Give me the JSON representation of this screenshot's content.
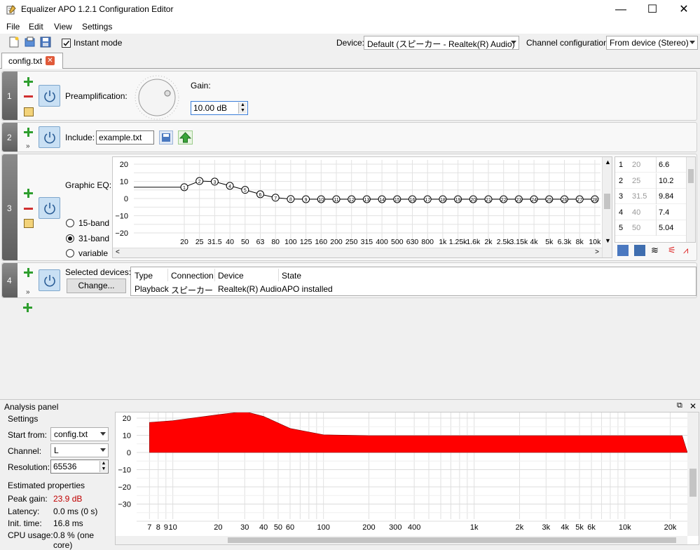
{
  "window": {
    "title": "Equalizer APO 1.2.1 Configuration Editor",
    "controls": {
      "minimize": "—",
      "maximize": "☐",
      "close": "✕"
    }
  },
  "menu": [
    "File",
    "Edit",
    "View",
    "Settings"
  ],
  "toolbar": {
    "instant_mode_label": "Instant mode",
    "instant_mode_checked": true,
    "device_label": "Device:",
    "device_value": "Default (スピーカー - Realtek(R) Audio)",
    "channel_config_label": "Channel configuration:",
    "channel_config_value": "From device (Stereo)"
  },
  "tab": {
    "name": "config.txt"
  },
  "filters": {
    "f1": {
      "num": "1",
      "label": "Preamplification:",
      "gain_label": "Gain:",
      "gain_value": "10.00 dB"
    },
    "f2": {
      "num": "2",
      "label": "Include:",
      "file_value": "example.txt"
    },
    "f3": {
      "num": "3",
      "label": "Graphic EQ:",
      "band15": "15-band",
      "band31": "31-band",
      "variable": "variable",
      "selected_mode": "31-band",
      "yticks": [
        "20",
        "10",
        "0",
        "−10",
        "−20"
      ],
      "xticks": [
        "20",
        "25",
        "31.5",
        "40",
        "50",
        "63",
        "80",
        "100",
        "125",
        "160",
        "200",
        "250",
        "315",
        "400",
        "500",
        "630",
        "800",
        "1k",
        "1.25k",
        "1.6k",
        "2k",
        "2.5k",
        "3.15k",
        "4k",
        "5k",
        "6.3k",
        "8k",
        "10k"
      ],
      "bands_table": [
        {
          "n": "1",
          "f": "20",
          "g": "6.6"
        },
        {
          "n": "2",
          "f": "25",
          "g": "10.2"
        },
        {
          "n": "3",
          "f": "31.5",
          "g": "9.84"
        },
        {
          "n": "4",
          "f": "40",
          "g": "7.4"
        },
        {
          "n": "5",
          "f": "50",
          "g": "5.04"
        }
      ]
    },
    "f4": {
      "num": "4",
      "label": "Selected devices:",
      "change_label": "Change...",
      "headers": [
        "Type",
        "Connection",
        "Device",
        "State"
      ],
      "row": [
        "Playback",
        "スピーカー",
        "Realtek(R) Audio",
        "APO installed"
      ]
    }
  },
  "analysis": {
    "title": "Analysis panel",
    "settings_header": "Settings",
    "start_from_label": "Start from:",
    "start_from_value": "config.txt",
    "channel_label": "Channel:",
    "channel_value": "L",
    "resolution_label": "Resolution:",
    "resolution_value": "65536",
    "estimated_header": "Estimated properties",
    "peak_gain_label": "Peak gain:",
    "peak_gain_value": "23.9 dB",
    "latency_label": "Latency:",
    "latency_value": "0.0 ms (0 s)",
    "init_time_label": "Init. time:",
    "init_time_value": "16.8 ms",
    "cpu_usage_label": "CPU usage:",
    "cpu_usage_value": "0.8 % (one core)",
    "response_color": "#ff0000",
    "yticks": [
      "20",
      "10",
      "0",
      "−10",
      "−20",
      "−30"
    ],
    "xticks": [
      "7",
      "8",
      "9",
      "10",
      "20",
      "30",
      "40",
      "50",
      "60",
      "100",
      "200",
      "300",
      "400",
      "1k",
      "2k",
      "3k",
      "4k",
      "5k",
      "6k",
      "10k",
      "20k"
    ]
  },
  "chart_data": [
    {
      "type": "line",
      "title": "",
      "xlabel": "",
      "ylabel": "",
      "ylim": [
        -20,
        20
      ],
      "x": [
        "20",
        "25",
        "31.5",
        "40",
        "50",
        "63",
        "80",
        "100",
        "125",
        "160",
        "200",
        "250",
        "315",
        "400",
        "500",
        "630",
        "800",
        "1k",
        "1.25k",
        "1.6k",
        "2k",
        "2.5k",
        "3.15k",
        "4k",
        "5k",
        "6.3k",
        "8k",
        "10k"
      ],
      "series": [
        {
          "values": [
            6.6,
            10.2,
            9.84,
            7.4,
            5.04,
            2.5,
            0.5,
            -0.3,
            -0.4,
            -0.4,
            -0.4,
            -0.4,
            -0.4,
            -0.4,
            -0.4,
            -0.4,
            -0.4,
            -0.4,
            -0.4,
            -0.4,
            -0.4,
            -0.4,
            -0.4,
            -0.4,
            -0.4,
            -0.4,
            -0.4,
            -0.4
          ]
        }
      ]
    },
    {
      "type": "area",
      "title": "",
      "xlabel": "",
      "ylabel": "",
      "ylim": [
        -35,
        20
      ],
      "x": [
        7,
        10,
        20,
        30,
        40,
        60,
        100,
        200,
        400,
        1000,
        2000,
        5000,
        10000,
        20000,
        24000
      ],
      "series": [
        {
          "values": [
            17.5,
            18.5,
            22,
            23.9,
            21,
            14,
            10.3,
            9.8,
            9.8,
            9.8,
            9.8,
            9.8,
            9.8,
            9.8,
            9.8
          ]
        }
      ]
    }
  ]
}
